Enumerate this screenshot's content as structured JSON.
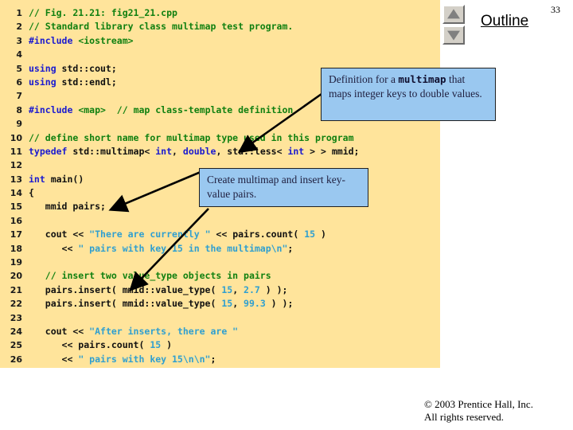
{
  "slide": {
    "number": "33",
    "outline_label": "Outline",
    "scroll_up_icon": "triangle-up-icon",
    "scroll_down_icon": "triangle-down-icon"
  },
  "code": {
    "lines": [
      {
        "n": "1",
        "tokens": [
          {
            "t": "// Fig. 21.21: fig21_21.cpp",
            "c": "cmt"
          }
        ]
      },
      {
        "n": "2",
        "tokens": [
          {
            "t": "// Standard library class multimap test program.",
            "c": "cmt"
          }
        ]
      },
      {
        "n": "3",
        "tokens": [
          {
            "t": "#include ",
            "c": "pre"
          },
          {
            "t": "<iostream>",
            "c": "cmt"
          }
        ]
      },
      {
        "n": "4",
        "tokens": []
      },
      {
        "n": "5",
        "tokens": [
          {
            "t": "using",
            "c": "kw"
          },
          {
            "t": " std::cout;",
            "c": "txt"
          }
        ]
      },
      {
        "n": "6",
        "tokens": [
          {
            "t": "using",
            "c": "kw"
          },
          {
            "t": " std::endl;",
            "c": "txt"
          }
        ]
      },
      {
        "n": "7",
        "tokens": []
      },
      {
        "n": "8",
        "tokens": [
          {
            "t": "#include ",
            "c": "pre"
          },
          {
            "t": "<map>",
            "c": "cmt"
          },
          {
            "t": "  ",
            "c": "txt"
          },
          {
            "t": "// map class-template definition",
            "c": "cmt"
          }
        ]
      },
      {
        "n": "9",
        "tokens": []
      },
      {
        "n": "10",
        "tokens": [
          {
            "t": "// define short name for multimap type used in this program",
            "c": "cmt"
          }
        ]
      },
      {
        "n": "11",
        "tokens": [
          {
            "t": "typedef",
            "c": "kw"
          },
          {
            "t": " std::multimap< ",
            "c": "txt"
          },
          {
            "t": "int",
            "c": "kw"
          },
          {
            "t": ", ",
            "c": "txt"
          },
          {
            "t": "double",
            "c": "kw"
          },
          {
            "t": ", std::less< ",
            "c": "txt"
          },
          {
            "t": "int",
            "c": "kw"
          },
          {
            "t": " > > mmid;",
            "c": "txt"
          }
        ]
      },
      {
        "n": "12",
        "tokens": []
      },
      {
        "n": "13",
        "tokens": [
          {
            "t": "int",
            "c": "kw"
          },
          {
            "t": " main()",
            "c": "txt"
          }
        ]
      },
      {
        "n": "14",
        "tokens": [
          {
            "t": "{",
            "c": "txt"
          }
        ]
      },
      {
        "n": "15",
        "tokens": [
          {
            "t": "   mmid pairs;",
            "c": "txt"
          }
        ]
      },
      {
        "n": "16",
        "tokens": []
      },
      {
        "n": "17",
        "tokens": [
          {
            "t": "   cout << ",
            "c": "txt"
          },
          {
            "t": "\"There are currently \"",
            "c": "str"
          },
          {
            "t": " << pairs.count( ",
            "c": "txt"
          },
          {
            "t": "15",
            "c": "num"
          },
          {
            "t": " )",
            "c": "txt"
          }
        ]
      },
      {
        "n": "18",
        "tokens": [
          {
            "t": "      << ",
            "c": "txt"
          },
          {
            "t": "\" pairs with key 15 in the multimap\\n\"",
            "c": "str"
          },
          {
            "t": ";",
            "c": "txt"
          }
        ]
      },
      {
        "n": "19",
        "tokens": []
      },
      {
        "n": "20",
        "tokens": [
          {
            "t": "   // insert two value_type objects in pairs",
            "c": "cmt"
          }
        ]
      },
      {
        "n": "21",
        "tokens": [
          {
            "t": "   pairs.insert( mmid::value_type( ",
            "c": "txt"
          },
          {
            "t": "15",
            "c": "num"
          },
          {
            "t": ", ",
            "c": "txt"
          },
          {
            "t": "2.7",
            "c": "num"
          },
          {
            "t": " ) );",
            "c": "txt"
          }
        ]
      },
      {
        "n": "22",
        "tokens": [
          {
            "t": "   pairs.insert( mmid::value_type( ",
            "c": "txt"
          },
          {
            "t": "15",
            "c": "num"
          },
          {
            "t": ", ",
            "c": "txt"
          },
          {
            "t": "99.3",
            "c": "num"
          },
          {
            "t": " ) );",
            "c": "txt"
          }
        ]
      },
      {
        "n": "23",
        "tokens": []
      },
      {
        "n": "24",
        "tokens": [
          {
            "t": "   cout << ",
            "c": "txt"
          },
          {
            "t": "\"After inserts, there are \"",
            "c": "str"
          }
        ]
      },
      {
        "n": "25",
        "tokens": [
          {
            "t": "      << pairs.count( ",
            "c": "txt"
          },
          {
            "t": "15",
            "c": "num"
          },
          {
            "t": " )",
            "c": "txt"
          }
        ]
      },
      {
        "n": "26",
        "tokens": [
          {
            "t": "      << ",
            "c": "txt"
          },
          {
            "t": "\" pairs with key 15\\n\\n\"",
            "c": "str"
          },
          {
            "t": ";",
            "c": "txt"
          }
        ]
      }
    ]
  },
  "callouts": [
    {
      "id": "callout-1",
      "parts": [
        {
          "t": "Definition for a ",
          "mono": false
        },
        {
          "t": "multimap",
          "mono": true
        },
        {
          "t": " that maps integer keys to double values.",
          "mono": false
        }
      ]
    },
    {
      "id": "callout-2",
      "parts": [
        {
          "t": "Create multimap and insert key-value pairs.",
          "mono": false
        }
      ]
    }
  ],
  "footer": {
    "line1": "© 2003 Prentice Hall, Inc.",
    "line2": "All rights reserved."
  },
  "colors": {
    "panel_bg": "#ffe49b",
    "callout_bg": "#9ac8f0",
    "comment": "#108010",
    "keyword": "#1a1ad0",
    "string": "#2f9fd0"
  }
}
